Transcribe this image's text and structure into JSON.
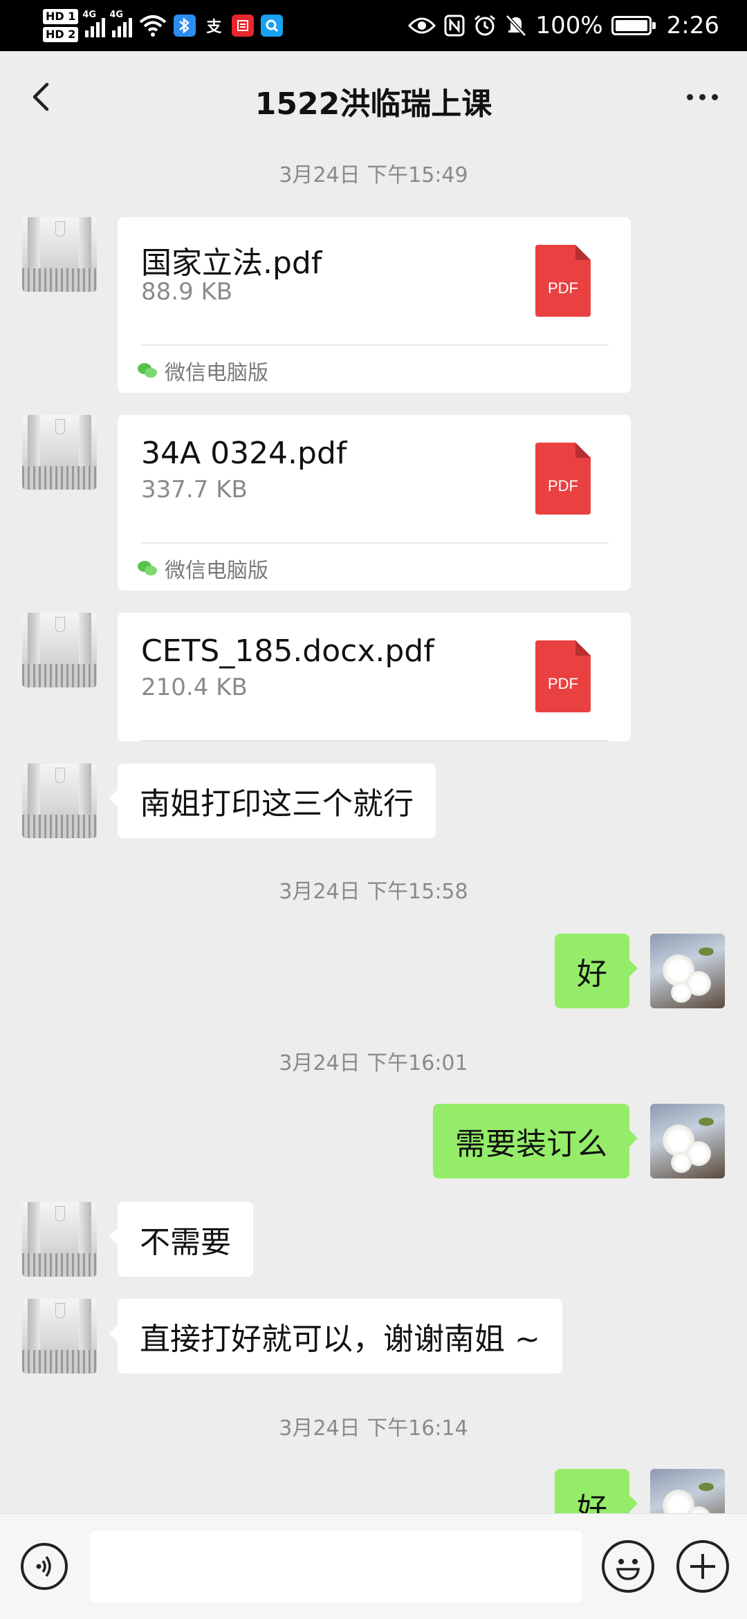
{
  "status_bar": {
    "sim1": "HD 1",
    "sim2": "HD 2",
    "network1": "4G",
    "network2": "4G",
    "app_icons": [
      "bluetooth-app-icon",
      "alipay-icon",
      "news-app-icon",
      "search-app-icon"
    ],
    "alipay_glyph": "支",
    "battery_percent": "100%",
    "time": "2:26"
  },
  "header": {
    "title": "1522洪临瑞上课"
  },
  "messages": [
    {
      "type": "timestamp",
      "text": "3月24日 下午15:49"
    },
    {
      "type": "file",
      "side": "left",
      "filename": "国家立法.pdf",
      "size": "88.9 KB",
      "source": "微信电脑版",
      "icon_label": "PDF"
    },
    {
      "type": "file",
      "side": "left",
      "filename": "34A 0324.pdf",
      "size": "337.7 KB",
      "source": "微信电脑版",
      "icon_label": "PDF"
    },
    {
      "type": "file",
      "side": "left",
      "filename": "CETS_185.docx.pdf",
      "size": "210.4 KB",
      "icon_label": "PDF"
    },
    {
      "type": "text",
      "side": "left",
      "text": "南姐打印这三个就行"
    },
    {
      "type": "timestamp",
      "text": "3月24日 下午15:58"
    },
    {
      "type": "text",
      "side": "right",
      "text": "好"
    },
    {
      "type": "timestamp",
      "text": "3月24日 下午16:01"
    },
    {
      "type": "text",
      "side": "right",
      "text": "需要装订么"
    },
    {
      "type": "text",
      "side": "left",
      "text": "不需要"
    },
    {
      "type": "text",
      "side": "left",
      "text": "直接打好就可以，谢谢南姐 ~"
    },
    {
      "type": "timestamp",
      "text": "3月24日 下午16:14"
    },
    {
      "type": "text",
      "side": "right",
      "text": "好"
    }
  ],
  "input_bar": {
    "input_value": "",
    "voice_icon": "voice-icon",
    "emoji_icon": "emoji-icon",
    "plus_icon": "plus-icon"
  },
  "colors": {
    "background": "#ededed",
    "sent_bubble": "#95ec69",
    "received_bubble": "#ffffff",
    "pdf_red": "#e94141"
  }
}
